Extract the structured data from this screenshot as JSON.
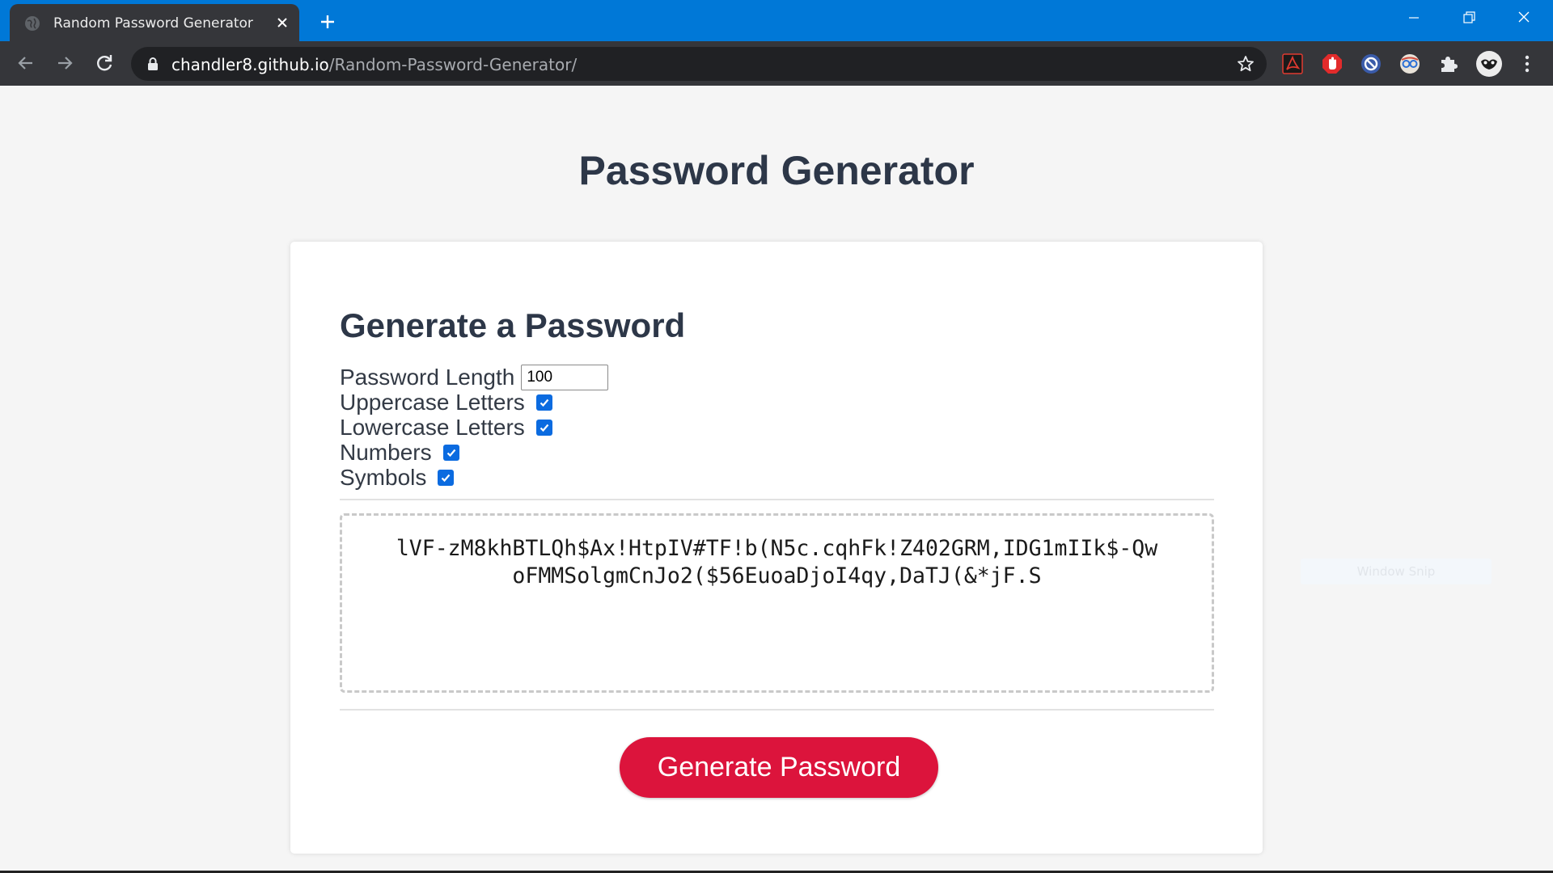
{
  "browser": {
    "tab_title": "Random Password Generator",
    "url_host": "chandler8.github.io",
    "url_path": "/Random-Password-Generator/",
    "accent_color": "#0078d7",
    "icons": [
      "back-icon",
      "forward-icon",
      "reload-icon",
      "lock-icon",
      "star-icon",
      "pdf-extension-icon",
      "adblock-extension-icon",
      "block-extension-icon",
      "reader-extension-icon",
      "puzzle-extension-icon",
      "profile-avatar",
      "more-menu-icon"
    ]
  },
  "page": {
    "title": "Password Generator"
  },
  "card": {
    "title": "Generate a Password",
    "options": {
      "length_label": "Password Length",
      "length_value": "100",
      "uppercase_label": "Uppercase Letters",
      "uppercase_checked": true,
      "lowercase_label": "Lowercase Letters",
      "lowercase_checked": true,
      "numbers_label": "Numbers",
      "numbers_checked": true,
      "symbols_label": "Symbols",
      "symbols_checked": true
    },
    "password": "lVF-zM8khBTLQh$Ax!HtpIV#TF!b(N5c.cqhFk!Z402GRM,IDG1mIIk$-QwoFMMSolgmCnJo2($56EuoaDjoI4qy,DaTJ(&*jF.S",
    "button_label": "Generate Password",
    "button_color": "#dc143c"
  },
  "overlay": {
    "ghost_text": "Window Snip"
  }
}
